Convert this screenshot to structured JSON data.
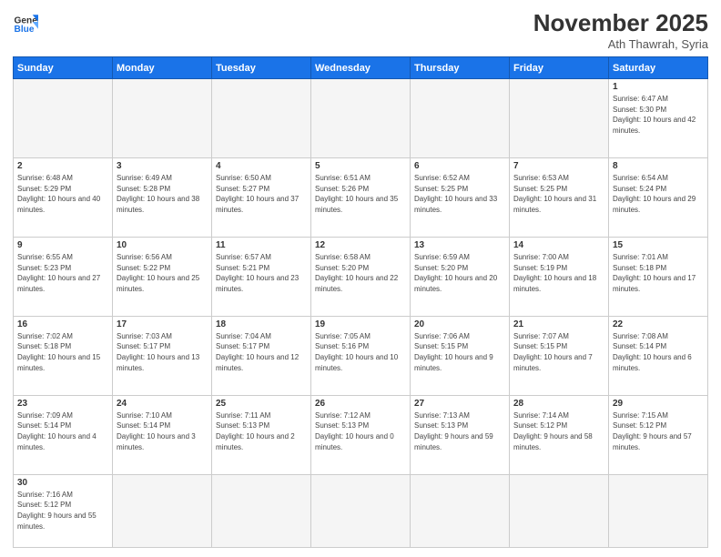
{
  "header": {
    "logo_general": "General",
    "logo_blue": "Blue",
    "month_title": "November 2025",
    "subtitle": "Ath Thawrah, Syria"
  },
  "days_of_week": [
    "Sunday",
    "Monday",
    "Tuesday",
    "Wednesday",
    "Thursday",
    "Friday",
    "Saturday"
  ],
  "weeks": [
    [
      {
        "num": "",
        "info": ""
      },
      {
        "num": "",
        "info": ""
      },
      {
        "num": "",
        "info": ""
      },
      {
        "num": "",
        "info": ""
      },
      {
        "num": "",
        "info": ""
      },
      {
        "num": "",
        "info": ""
      },
      {
        "num": "1",
        "info": "Sunrise: 6:47 AM\nSunset: 5:30 PM\nDaylight: 10 hours and 42 minutes."
      }
    ],
    [
      {
        "num": "2",
        "info": "Sunrise: 6:48 AM\nSunset: 5:29 PM\nDaylight: 10 hours and 40 minutes."
      },
      {
        "num": "3",
        "info": "Sunrise: 6:49 AM\nSunset: 5:28 PM\nDaylight: 10 hours and 38 minutes."
      },
      {
        "num": "4",
        "info": "Sunrise: 6:50 AM\nSunset: 5:27 PM\nDaylight: 10 hours and 37 minutes."
      },
      {
        "num": "5",
        "info": "Sunrise: 6:51 AM\nSunset: 5:26 PM\nDaylight: 10 hours and 35 minutes."
      },
      {
        "num": "6",
        "info": "Sunrise: 6:52 AM\nSunset: 5:25 PM\nDaylight: 10 hours and 33 minutes."
      },
      {
        "num": "7",
        "info": "Sunrise: 6:53 AM\nSunset: 5:25 PM\nDaylight: 10 hours and 31 minutes."
      },
      {
        "num": "8",
        "info": "Sunrise: 6:54 AM\nSunset: 5:24 PM\nDaylight: 10 hours and 29 minutes."
      }
    ],
    [
      {
        "num": "9",
        "info": "Sunrise: 6:55 AM\nSunset: 5:23 PM\nDaylight: 10 hours and 27 minutes."
      },
      {
        "num": "10",
        "info": "Sunrise: 6:56 AM\nSunset: 5:22 PM\nDaylight: 10 hours and 25 minutes."
      },
      {
        "num": "11",
        "info": "Sunrise: 6:57 AM\nSunset: 5:21 PM\nDaylight: 10 hours and 23 minutes."
      },
      {
        "num": "12",
        "info": "Sunrise: 6:58 AM\nSunset: 5:20 PM\nDaylight: 10 hours and 22 minutes."
      },
      {
        "num": "13",
        "info": "Sunrise: 6:59 AM\nSunset: 5:20 PM\nDaylight: 10 hours and 20 minutes."
      },
      {
        "num": "14",
        "info": "Sunrise: 7:00 AM\nSunset: 5:19 PM\nDaylight: 10 hours and 18 minutes."
      },
      {
        "num": "15",
        "info": "Sunrise: 7:01 AM\nSunset: 5:18 PM\nDaylight: 10 hours and 17 minutes."
      }
    ],
    [
      {
        "num": "16",
        "info": "Sunrise: 7:02 AM\nSunset: 5:18 PM\nDaylight: 10 hours and 15 minutes."
      },
      {
        "num": "17",
        "info": "Sunrise: 7:03 AM\nSunset: 5:17 PM\nDaylight: 10 hours and 13 minutes."
      },
      {
        "num": "18",
        "info": "Sunrise: 7:04 AM\nSunset: 5:17 PM\nDaylight: 10 hours and 12 minutes."
      },
      {
        "num": "19",
        "info": "Sunrise: 7:05 AM\nSunset: 5:16 PM\nDaylight: 10 hours and 10 minutes."
      },
      {
        "num": "20",
        "info": "Sunrise: 7:06 AM\nSunset: 5:15 PM\nDaylight: 10 hours and 9 minutes."
      },
      {
        "num": "21",
        "info": "Sunrise: 7:07 AM\nSunset: 5:15 PM\nDaylight: 10 hours and 7 minutes."
      },
      {
        "num": "22",
        "info": "Sunrise: 7:08 AM\nSunset: 5:14 PM\nDaylight: 10 hours and 6 minutes."
      }
    ],
    [
      {
        "num": "23",
        "info": "Sunrise: 7:09 AM\nSunset: 5:14 PM\nDaylight: 10 hours and 4 minutes."
      },
      {
        "num": "24",
        "info": "Sunrise: 7:10 AM\nSunset: 5:14 PM\nDaylight: 10 hours and 3 minutes."
      },
      {
        "num": "25",
        "info": "Sunrise: 7:11 AM\nSunset: 5:13 PM\nDaylight: 10 hours and 2 minutes."
      },
      {
        "num": "26",
        "info": "Sunrise: 7:12 AM\nSunset: 5:13 PM\nDaylight: 10 hours and 0 minutes."
      },
      {
        "num": "27",
        "info": "Sunrise: 7:13 AM\nSunset: 5:13 PM\nDaylight: 9 hours and 59 minutes."
      },
      {
        "num": "28",
        "info": "Sunrise: 7:14 AM\nSunset: 5:12 PM\nDaylight: 9 hours and 58 minutes."
      },
      {
        "num": "29",
        "info": "Sunrise: 7:15 AM\nSunset: 5:12 PM\nDaylight: 9 hours and 57 minutes."
      }
    ],
    [
      {
        "num": "30",
        "info": "Sunrise: 7:16 AM\nSunset: 5:12 PM\nDaylight: 9 hours and 55 minutes."
      },
      {
        "num": "",
        "info": ""
      },
      {
        "num": "",
        "info": ""
      },
      {
        "num": "",
        "info": ""
      },
      {
        "num": "",
        "info": ""
      },
      {
        "num": "",
        "info": ""
      },
      {
        "num": "",
        "info": ""
      }
    ]
  ]
}
